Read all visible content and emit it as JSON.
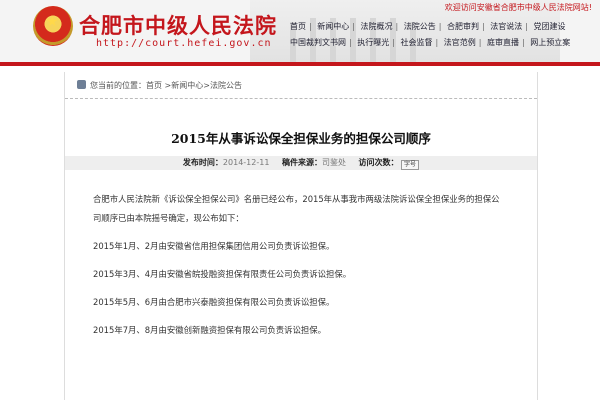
{
  "header": {
    "title": "合肥市中级人民法院",
    "url": "http://court.hefei.gov.cn",
    "welcome": "欢迎访问安徽省合肥市中级人民法院网站!"
  },
  "nav": {
    "row1": [
      "首页",
      "新闻中心",
      "法院概况",
      "法院公告",
      "合肥审判",
      "法官说法",
      "党团建设"
    ],
    "row2": [
      "中国裁判文书网",
      "执行曝光",
      "社会监督",
      "法官范例",
      "庭审直播",
      "网上预立案"
    ]
  },
  "breadcrumb": {
    "text": "您当前的位置：首页 >新闻中心>法院公告"
  },
  "article": {
    "title": "2015年从事诉讼保全担保业务的担保公司顺序",
    "publish_label": "发布时间：",
    "publish_date": "2014-12-11",
    "source_label": "稿件来源：",
    "source": "司鉴处",
    "visits_label": "访问次数：",
    "font_icon": "字号",
    "paragraphs": [
      "合肥市人民法院新《诉讼保全担保公司》名册已经公布，2015年从事我市两级法院诉讼保全担保业务的担保公司顺序已由本院摇号确定，现公布如下：",
      "2015年1月、2月由安徽省信用担保集团信用公司负责诉讼担保。",
      "2015年3月、4月由安徽省皖投融资担保有限责任公司负责诉讼担保。",
      "2015年5月、6月由合肥市兴泰融资担保有限公司负责诉讼担保。",
      "2015年7月、8月由安徽创新融资担保有限公司负责诉讼担保。"
    ]
  },
  "colors": {
    "brand_red": "#c4161c",
    "meta_bar": "#eeeeee"
  }
}
